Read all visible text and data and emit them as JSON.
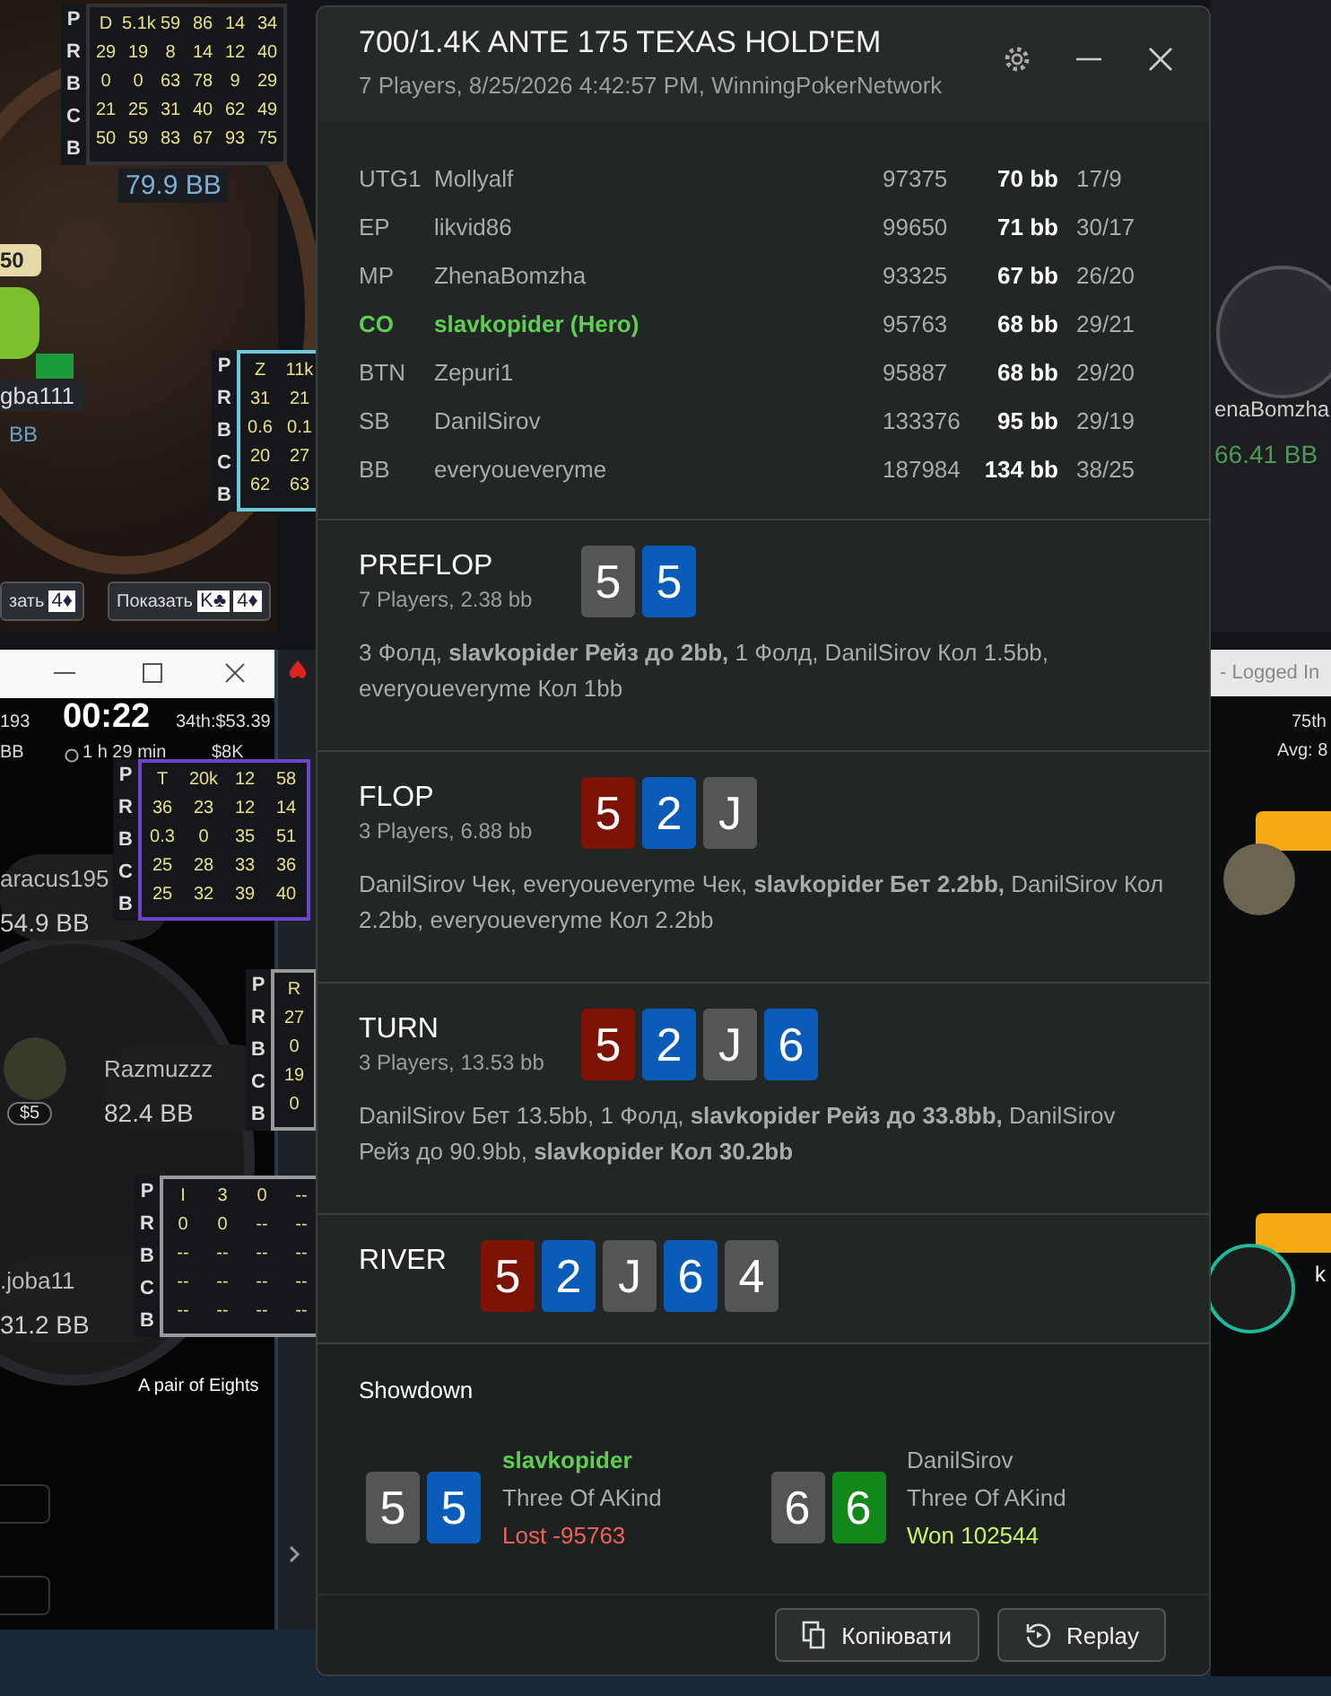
{
  "background": {
    "huds": [
      {
        "letters": [
          "P",
          "R",
          "B",
          "C",
          "B"
        ],
        "rows": [
          [
            "D",
            "5.1k",
            "59",
            "86",
            "14",
            "34"
          ],
          [
            "29",
            "19",
            "8",
            "14",
            "12",
            "40"
          ],
          [
            "0",
            "0",
            "63",
            "78",
            "9",
            "29"
          ],
          [
            "21",
            "25",
            "31",
            "40",
            "62",
            "49"
          ],
          [
            "50",
            "59",
            "83",
            "67",
            "93",
            "75"
          ]
        ]
      },
      {
        "letters": [
          "P",
          "R",
          "B",
          "C",
          "B"
        ],
        "rows": [
          [
            "Z",
            "11k"
          ],
          [
            "31",
            "21"
          ],
          [
            "0.6",
            "0.1"
          ],
          [
            "20",
            "27"
          ],
          [
            "62",
            "63"
          ]
        ]
      },
      {
        "letters": [
          "P",
          "R",
          "B",
          "C",
          "B"
        ],
        "rows": [
          [
            "T",
            "20k",
            "12",
            "58"
          ],
          [
            "36",
            "23",
            "12",
            "14"
          ],
          [
            "0.3",
            "0",
            "35",
            "51"
          ],
          [
            "25",
            "28",
            "33",
            "36"
          ],
          [
            "25",
            "32",
            "39",
            "40"
          ]
        ]
      },
      {
        "letters": [
          "P",
          "R",
          "B",
          "C",
          "B"
        ],
        "rows": [
          [
            "R"
          ],
          [
            "27"
          ],
          [
            "0"
          ],
          [
            "19"
          ],
          [
            "0"
          ]
        ]
      },
      {
        "letters": [
          "P",
          "R",
          "B",
          "C",
          "B"
        ],
        "rows": [
          [
            "I",
            "3",
            "0",
            "--"
          ],
          [
            "0",
            "0",
            "--",
            "--"
          ],
          [
            "--",
            "--",
            "--",
            "--"
          ],
          [
            "--",
            "--",
            "--",
            "--"
          ],
          [
            "--",
            "--",
            "--",
            "--"
          ]
        ]
      }
    ],
    "top_left_table": {
      "stack": "79.9 BB",
      "bet": "50",
      "player_name": "gba111",
      "player_tag": "BB",
      "show_buttons": [
        {
          "label": "зать",
          "cards": [
            "4♦"
          ]
        },
        {
          "label": "Показать",
          "cards": [
            "K♣",
            "4♦"
          ]
        }
      ]
    },
    "left_window": {
      "left_info": "193",
      "clock": "00:22",
      "place": "34th:$53.39",
      "left_info_2": "BB",
      "elapsed": "1 h 29 min",
      "prize": "$8K",
      "seats": [
        {
          "name": "aracus195",
          "stack": "54.9 BB"
        },
        {
          "name": "Razmuzzz",
          "stack": "82.4 BB",
          "bounty": "$5"
        },
        {
          "name": ".joba11",
          "stack": "31.2 BB"
        }
      ],
      "hand_text": "A pair of Eights"
    },
    "right_table": {
      "player_name": "enaBomzha",
      "stack": "66.41 BB"
    },
    "right_window": {
      "title": "- Logged In",
      "rank": "75th",
      "avg": "Avg: 8",
      "player_name": "k"
    }
  },
  "window": {
    "title": "700/1.4K ANTE 175 TEXAS HOLD'EM",
    "subtitle": "7 Players, 8/25/2026 4:42:57 PM, WinningPokerNetwork"
  },
  "players": [
    {
      "position": "UTG1",
      "name": "Mollyalf",
      "stack": "97375",
      "bb": "70 bb",
      "stats": "17/9",
      "hero": false
    },
    {
      "position": "EP",
      "name": "likvid86",
      "stack": "99650",
      "bb": "71 bb",
      "stats": "30/17",
      "hero": false
    },
    {
      "position": "MP",
      "name": "ZhenaBomzha",
      "stack": "93325",
      "bb": "67 bb",
      "stats": "26/20",
      "hero": false
    },
    {
      "position": "CO",
      "name": "slavkopider (Hero)",
      "stack": "95763",
      "bb": "68 bb",
      "stats": "29/21",
      "hero": true
    },
    {
      "position": "BTN",
      "name": "Zepuri1",
      "stack": "95887",
      "bb": "68 bb",
      "stats": "29/20",
      "hero": false
    },
    {
      "position": "SB",
      "name": "DanilSirov",
      "stack": "133376",
      "bb": "95 bb",
      "stats": "29/19",
      "hero": false
    },
    {
      "position": "BB",
      "name": "everyoueveryme",
      "stack": "187984",
      "bb": "134 bb",
      "stats": "38/25",
      "hero": false
    }
  ],
  "streets": [
    {
      "name": "PREFLOP",
      "info": "7 Players, 2.38 bb",
      "cards": [
        {
          "rank": "5",
          "color": "#555555"
        },
        {
          "rank": "5",
          "color": "#0b5cb8"
        }
      ],
      "actions": "3 Фолд, **slavkopider Рейз до 2bb,** 1 Фолд, DanilSirov Кол 1.5bb, everyoueveryme Кол 1bb"
    },
    {
      "name": "FLOP",
      "info": "3 Players, 6.88 bb",
      "cards": [
        {
          "rank": "5",
          "color": "#7d1206"
        },
        {
          "rank": "2",
          "color": "#0b5cb8"
        },
        {
          "rank": "J",
          "color": "#555555"
        }
      ],
      "actions": "DanilSirov Чек, everyoueveryme Чек, **slavkopider Бет 2.2bb,** DanilSirov Кол 2.2bb, everyoueveryme Кол 2.2bb"
    },
    {
      "name": "TURN",
      "info": "3 Players, 13.53 bb",
      "cards": [
        {
          "rank": "5",
          "color": "#7d1206"
        },
        {
          "rank": "2",
          "color": "#0b5cb8"
        },
        {
          "rank": "J",
          "color": "#555555"
        },
        {
          "rank": "6",
          "color": "#0b5cb8"
        }
      ],
      "actions": "DanilSirov Бет 13.5bb, 1 Фолд, **slavkopider Рейз до 33.8bb,** DanilSirov Рейз до 90.9bb, **slavkopider Кол 30.2bb**"
    },
    {
      "name": "RIVER",
      "cards": [
        {
          "rank": "5",
          "color": "#7d1206"
        },
        {
          "rank": "2",
          "color": "#0b5cb8"
        },
        {
          "rank": "J",
          "color": "#555555"
        },
        {
          "rank": "6",
          "color": "#0b5cb8"
        },
        {
          "rank": "4",
          "color": "#555555"
        }
      ]
    }
  ],
  "showdown": {
    "title": "Showdown",
    "players": [
      {
        "name": "slavkopider",
        "hero": true,
        "hand": "Three Of AKind",
        "result": "Lost -95763",
        "won": false,
        "cards": [
          {
            "rank": "5",
            "color": "#555555"
          },
          {
            "rank": "5",
            "color": "#0b5cb8"
          }
        ]
      },
      {
        "name": "DanilSirov",
        "hero": false,
        "hand": "Three Of AKind",
        "result": "Won 102544",
        "won": true,
        "cards": [
          {
            "rank": "6",
            "color": "#555555"
          },
          {
            "rank": "6",
            "color": "#12871a"
          }
        ]
      }
    ]
  },
  "buttons": [
    {
      "label": "Копіювати",
      "kind": "copy"
    },
    {
      "label": "Replay",
      "kind": "replay"
    }
  ]
}
